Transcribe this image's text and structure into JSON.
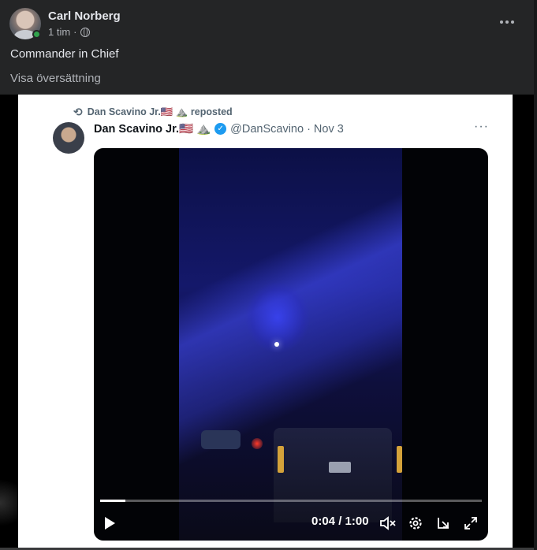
{
  "post": {
    "author": "Carl Norberg",
    "timestamp": "1 tim",
    "separator": "·",
    "privacy_icon": "globe-icon",
    "online": true,
    "text": "Commander in Chief",
    "translate_link": "Visa översättning",
    "more_icon": "more-horizontal-icon"
  },
  "embedded_tweet": {
    "repost_label": "Dan Scavino Jr.🇺🇸 ⛰️ reposted",
    "name": "Dan Scavino Jr.🇺🇸 ⛰️",
    "handle_date": "@DanScavino · Nov 3",
    "more_icon": "more-horizontal-icon",
    "verified_icon": "verified-badge-icon"
  },
  "video": {
    "time": "0:04 / 1:00",
    "progress": 0.067,
    "controls": [
      "play-icon",
      "mute-icon",
      "settings-icon",
      "pip-icon",
      "fullscreen-icon"
    ]
  },
  "colors": {
    "background": "#242526",
    "text_primary": "#e4e6eb",
    "text_secondary": "#b0b3b8",
    "online": "#31a24c",
    "verified": "#1d9bf0"
  }
}
